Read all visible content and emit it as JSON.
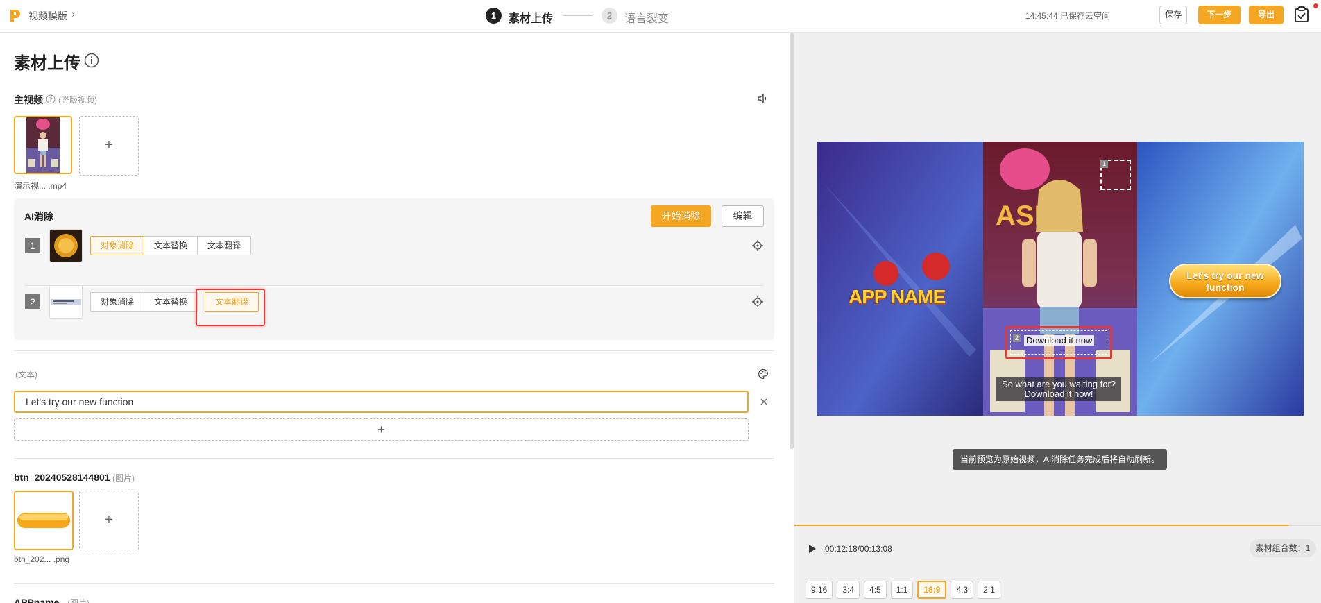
{
  "header": {
    "breadcrumb": "视频模版",
    "steps": [
      {
        "num": "1",
        "label": "素材上传"
      },
      {
        "num": "2",
        "label": "语言裂变"
      }
    ],
    "autosave": "14:45:44 已保存云空间",
    "save_label": "保存",
    "next_label": "下一步",
    "export_label": "导出"
  },
  "left": {
    "title": "素材上传",
    "main_video": {
      "title": "主视频",
      "subtitle": "(竖版视频)",
      "file_name": "演示视...   .mp4",
      "add_symbol": "+"
    },
    "ai_erase": {
      "title": "AI消除",
      "start_label": "开始消除",
      "edit_label": "编辑",
      "rows": [
        {
          "num": "1",
          "options": [
            "对象消除",
            "文本替换",
            "文本翻译"
          ],
          "selected": "对象消除"
        },
        {
          "num": "2",
          "options": [
            "对象消除",
            "文本替换",
            "文本翻译"
          ],
          "selected": "文本翻译"
        }
      ]
    },
    "text_section": {
      "label": "(文本)",
      "value": "Let's try our new function",
      "add_symbol": "+"
    },
    "btn_asset": {
      "title": "btn_20240528144801",
      "subtitle": "(图片)",
      "file_name": "btn_202...   .png",
      "add_symbol": "+"
    },
    "appname_asset": {
      "title": "APPname",
      "subtitle": "(图片)"
    }
  },
  "preview": {
    "app_name": "APP NAME",
    "lets_button": "Let's try our new function",
    "download_text": "Download it now",
    "caption": "So what are you waiting for? Download it now!",
    "box1_num": "1",
    "box2_num": "2",
    "toast": "当前预览为原始视频，AI消除任务完成后将自动刷新。",
    "time": "00:12:18/00:13:08",
    "progress": 0.94,
    "combo": "素材组合数：1",
    "ratios": [
      "9:16",
      "3:4",
      "4:5",
      "1:1",
      "16:9",
      "4:3",
      "2:1"
    ],
    "selected_ratio": "16:9"
  },
  "colors": {
    "accent": "#f5a623",
    "highlight": "#e53935"
  }
}
